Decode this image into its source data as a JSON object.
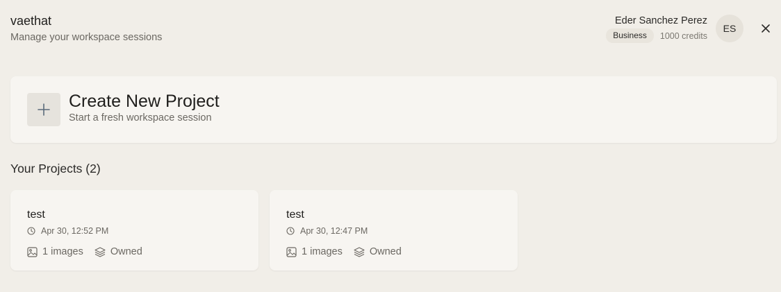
{
  "header": {
    "title": "vaethat",
    "subtitle": "Manage your workspace sessions"
  },
  "user": {
    "name": "Eder Sanchez Perez",
    "plan": "Business",
    "credits": "1000 credits",
    "initials": "ES"
  },
  "create": {
    "title": "Create New Project",
    "subtitle": "Start a fresh workspace session"
  },
  "projects_section": {
    "title": "Your Projects (2)"
  },
  "projects": [
    {
      "name": "test",
      "date": "Apr 30, 12:52 PM",
      "images": "1 images",
      "ownership": "Owned"
    },
    {
      "name": "test",
      "date": "Apr 30, 12:47 PM",
      "images": "1 images",
      "ownership": "Owned"
    }
  ],
  "icons": {
    "close": "close-icon",
    "plus": "plus-icon",
    "clock": "clock-icon",
    "image": "image-icon",
    "layers": "layers-icon"
  },
  "colors": {
    "background": "#f1eee8",
    "card": "#f7f5f1",
    "badge": "#e9e5dd",
    "accent_plus": "#5a6b7b"
  }
}
